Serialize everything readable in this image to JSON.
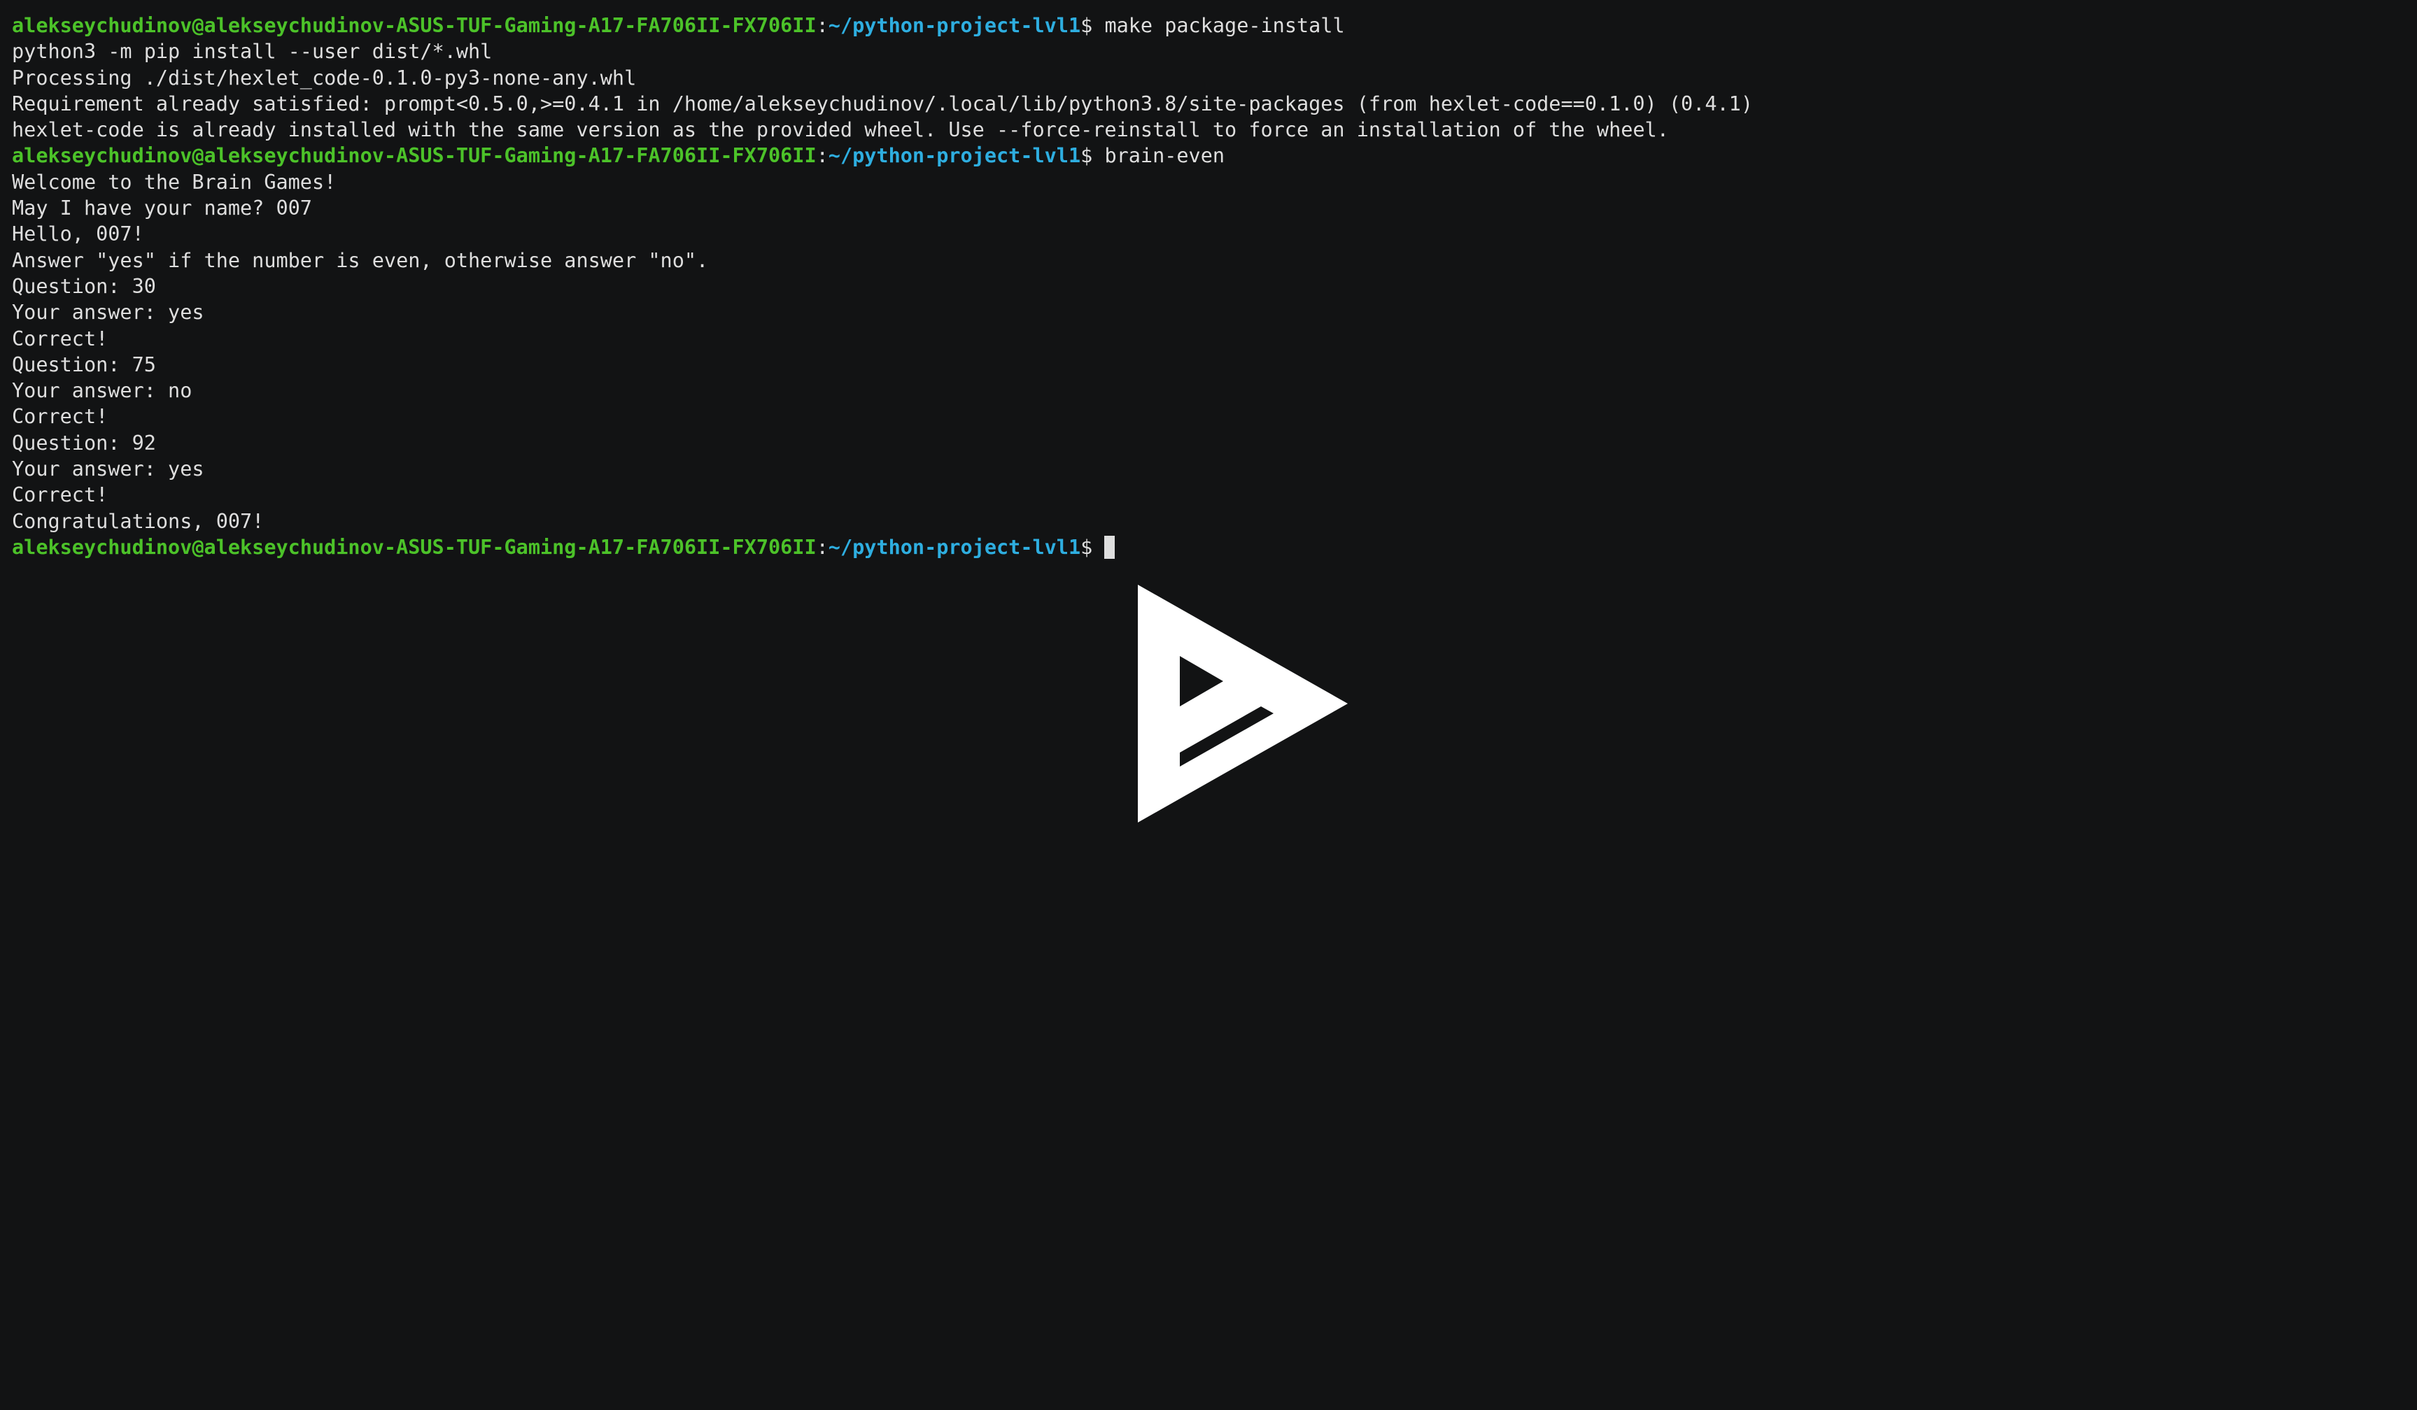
{
  "prompt": {
    "user_host": "alekseychudinov@alekseychudinov-ASUS-TUF-Gaming-A17-FA706II-FX706II",
    "separator": ":",
    "path": "~/python-project-lvl1",
    "symbol": "$ "
  },
  "session": [
    {
      "type": "command",
      "text": "make package-install"
    },
    {
      "type": "output",
      "text": "python3 -m pip install --user dist/*.whl"
    },
    {
      "type": "output",
      "text": "Processing ./dist/hexlet_code-0.1.0-py3-none-any.whl"
    },
    {
      "type": "output",
      "text": "Requirement already satisfied: prompt<0.5.0,>=0.4.1 in /home/alekseychudinov/.local/lib/python3.8/site-packages (from hexlet-code==0.1.0) (0.4.1)"
    },
    {
      "type": "output",
      "text": "hexlet-code is already installed with the same version as the provided wheel. Use --force-reinstall to force an installation of the wheel."
    },
    {
      "type": "command",
      "text": "brain-even"
    },
    {
      "type": "output",
      "text": "Welcome to the Brain Games!"
    },
    {
      "type": "output",
      "text": "May I have your name? 007"
    },
    {
      "type": "output",
      "text": "Hello, 007!"
    },
    {
      "type": "output",
      "text": "Answer \"yes\" if the number is even, otherwise answer \"no\"."
    },
    {
      "type": "output",
      "text": "Question: 30"
    },
    {
      "type": "output",
      "text": "Your answer: yes"
    },
    {
      "type": "output",
      "text": "Correct!"
    },
    {
      "type": "output",
      "text": "Question: 75"
    },
    {
      "type": "output",
      "text": "Your answer: no"
    },
    {
      "type": "output",
      "text": "Correct!"
    },
    {
      "type": "output",
      "text": "Question: 92"
    },
    {
      "type": "output",
      "text": "Your answer: yes"
    },
    {
      "type": "output",
      "text": "Correct!"
    },
    {
      "type": "output",
      "text": "Congratulations, 007!"
    },
    {
      "type": "command",
      "text": "",
      "cursor": true
    }
  ],
  "overlay": {
    "icon": "asciinema-play-icon",
    "color": "#ffffff"
  },
  "colors": {
    "background": "#121314",
    "text": "#dedede",
    "user_host": "#4cc229",
    "path": "#2eaee0"
  }
}
